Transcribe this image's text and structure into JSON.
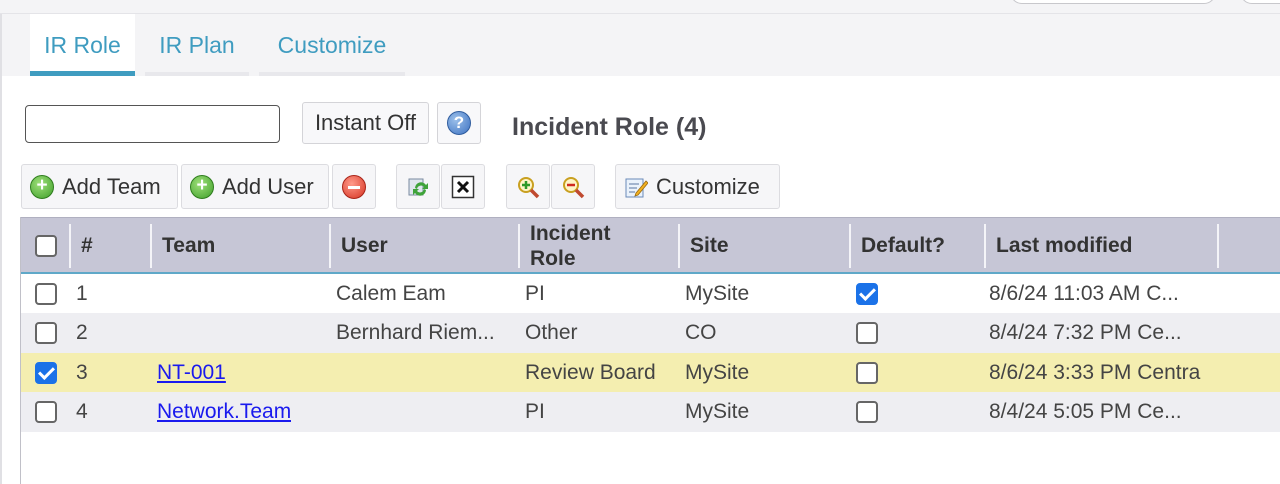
{
  "tabs": [
    {
      "label": "IR Role",
      "active": true
    },
    {
      "label": "IR Plan",
      "active": false
    },
    {
      "label": "Customize",
      "active": false
    }
  ],
  "search": {
    "value": "",
    "placeholder": ""
  },
  "instant_label": "Instant Off",
  "help_label": "?",
  "panel_title": "Incident Role (4)",
  "toolbar": {
    "add_team_label": "Add Team",
    "add_user_label": "Add User",
    "customize_label": "Customize",
    "icons": [
      "add-icon",
      "add-icon",
      "remove-icon",
      "refresh-icon",
      "clear-icon",
      "zoom-in-icon",
      "zoom-out-icon",
      "customize-icon"
    ]
  },
  "grid": {
    "columns": [
      "#",
      "Team",
      "User",
      "Incident Role",
      "Site",
      "Default?",
      "Last modified"
    ],
    "header_role_line1": "Incident",
    "header_role_line2": "Role",
    "rows": [
      {
        "selected": false,
        "num": "1",
        "team": "",
        "user": "Calem Eam",
        "role": "PI",
        "site": "MySite",
        "default": true,
        "modified": "8/6/24 11:03 AM C..."
      },
      {
        "selected": false,
        "num": "2",
        "team": "",
        "user": "Bernhard Riem...",
        "role": "Other",
        "site": "CO",
        "default": false,
        "modified": "8/4/24 7:32 PM Ce..."
      },
      {
        "selected": true,
        "num": "3",
        "team": "NT-001",
        "user": "",
        "role": "Review Board",
        "site": "MySite",
        "default": false,
        "modified": "8/6/24 3:33 PM Centra"
      },
      {
        "selected": false,
        "num": "4",
        "team": "Network.Team",
        "user": "",
        "role": "PI",
        "site": "MySite",
        "default": false,
        "modified": "8/4/24 5:05 PM Ce..."
      }
    ]
  },
  "colors": {
    "accent": "#3f9cc0",
    "header_bg": "#c6c6d6",
    "selected_row": "#f4eeb0",
    "link": "#1a1aee",
    "checkbox_checked": "#1b72e8"
  }
}
